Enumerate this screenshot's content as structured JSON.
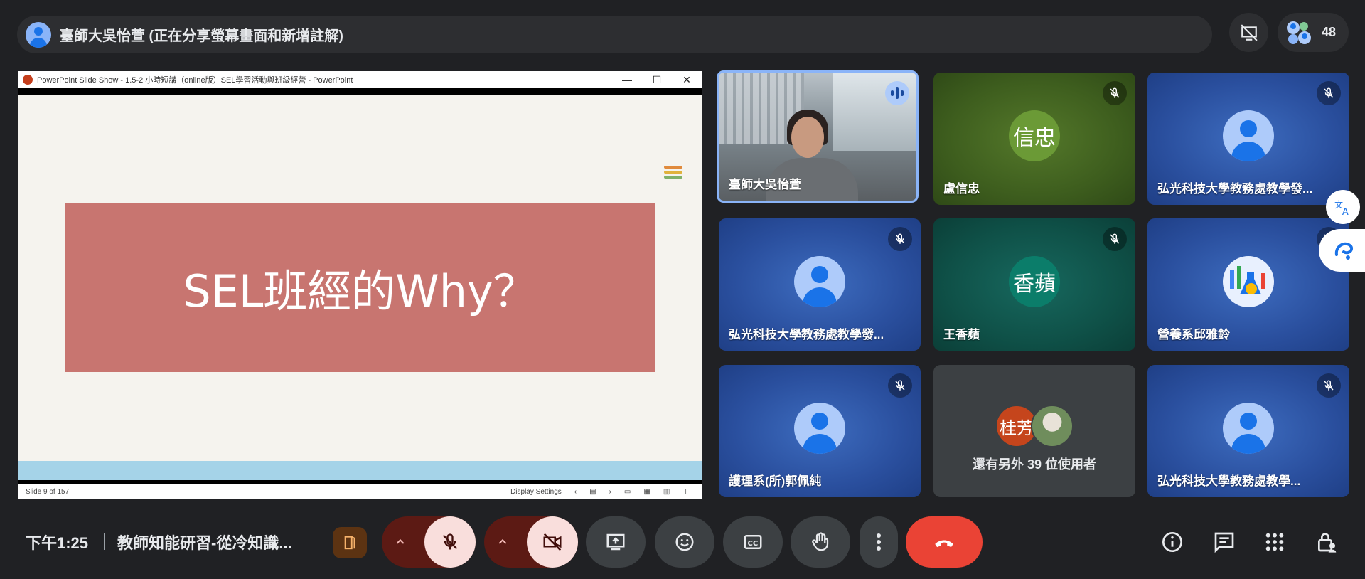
{
  "presenter": {
    "label": "臺師大吳怡萱 (正在分享螢幕畫面和新增註解)"
  },
  "top_controls": {
    "participant_count": "48"
  },
  "shared_screen": {
    "window_title": "PowerPoint Slide Show  -  1.5-2 小時短講（online版）SEL學習活動與班級經營 - PowerPoint",
    "slide_heading": "SEL班經的Why？",
    "slide_counter": "Slide 9 of 157",
    "display_settings": "Display Settings",
    "accent_lines": [
      "#e08a3c",
      "#e0b23c",
      "#7fb069"
    ]
  },
  "tiles": [
    {
      "name": "臺師大吳怡萱",
      "type": "video",
      "state": "speaking"
    },
    {
      "name": "盧信忠",
      "type": "letter",
      "initials": "信忠",
      "avatar_color": "#6b9a36",
      "state": "muted"
    },
    {
      "name": "弘光科技大學教務處教學發...",
      "type": "default",
      "state": "muted"
    },
    {
      "name": "弘光科技大學教務處教學發...",
      "type": "default",
      "state": "muted"
    },
    {
      "name": "王香蘋",
      "type": "letter",
      "initials": "香蘋",
      "avatar_color": "#0b7d6a",
      "state": "muted"
    },
    {
      "name": "營養系邱雅鈴",
      "type": "illustration",
      "state": "muted"
    },
    {
      "name": "護理系(所)郭佩純",
      "type": "default",
      "state": "muted"
    },
    {
      "name": "還有另外 39 位使用者",
      "type": "more",
      "initials": "桂芳",
      "avatar_color": "#c5451c"
    },
    {
      "name": "弘光科技大學教務處教學...",
      "type": "default",
      "state": "muted"
    }
  ],
  "bottom_bar": {
    "time": "下午1:25",
    "meeting_title": "教師知能研習-從冷知識..."
  },
  "colors": {
    "background": "#202124",
    "end_call": "#ea4335",
    "muted_control": "#f9dedc",
    "accent_blue": "#8ab4f8"
  },
  "icons": [
    "person-icon",
    "no-slides-icon",
    "people-icon",
    "mic-off-icon",
    "video-off-icon",
    "present-icon",
    "emoji-icon",
    "captions-icon",
    "raise-hand-icon",
    "more-vert-icon",
    "end-call-icon",
    "info-icon",
    "chat-icon",
    "activities-icon",
    "host-controls-icon",
    "translate-icon",
    "assistant-icon",
    "room-icon"
  ]
}
